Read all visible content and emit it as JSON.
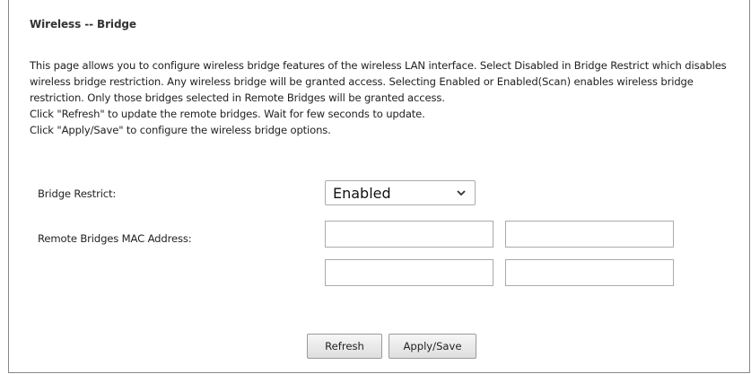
{
  "page": {
    "title": "Wireless -- Bridge",
    "description": [
      "This page allows you to configure wireless bridge features of the wireless LAN interface. Select Disabled in Bridge Restrict which disables wireless bridge restriction. Any wireless bridge will be granted access. Selecting Enabled or Enabled(Scan) enables wireless bridge restriction. Only those bridges selected in Remote Bridges will be granted access.",
      "Click \"Refresh\" to update the remote bridges. Wait for few seconds to update.",
      "Click \"Apply/Save\" to configure the wireless bridge options."
    ]
  },
  "form": {
    "bridge_restrict_label": "Bridge Restrict:",
    "bridge_restrict_value": "Enabled",
    "remote_mac_label": "Remote Bridges MAC Address:",
    "mac_1": "",
    "mac_2": "",
    "mac_3": "",
    "mac_4": ""
  },
  "buttons": {
    "refresh": "Refresh",
    "apply_save": "Apply/Save"
  }
}
